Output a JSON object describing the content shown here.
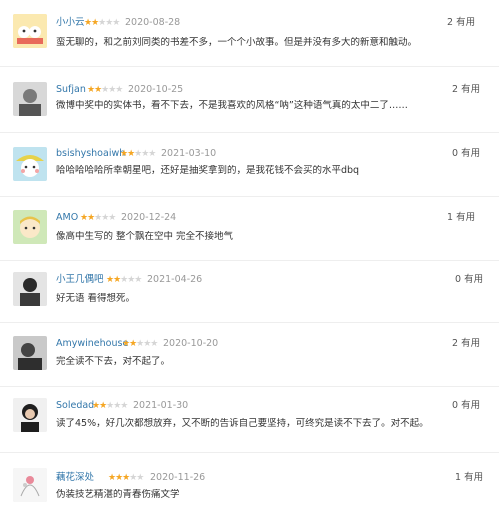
{
  "reviews": [
    {
      "user": "小小云",
      "rating": 2,
      "date": "2020-08-28",
      "text": "蛮无聊的，和之前刘同类的书差不多，一个个小故事。但是并没有多大的新意和触动。",
      "useful": "2 有用"
    },
    {
      "user": "Sufjan",
      "rating": 2,
      "date": "2020-10-25",
      "text": "微博中奖中的实体书，看不下去，不是我喜欢的风格“呐”这种语气真的太中二了……",
      "useful": "2 有用"
    },
    {
      "user": "bsishyshoaiwh",
      "rating": 2,
      "date": "2021-03-10",
      "text": "哈哈哈哈哈所幸朝星吧，还好是抽奖拿到的，是我花钱不会买的水平dbq",
      "useful": "0 有用"
    },
    {
      "user": "AMO",
      "rating": 2,
      "date": "2020-12-24",
      "text": "像高中生写的 整个飘在空中 完全不接地气",
      "useful": "1 有用"
    },
    {
      "user": "小王几偶吧",
      "rating": 2,
      "date": "2021-04-26",
      "text": "好无语 看得想死。",
      "useful": "0 有用"
    },
    {
      "user": "Amywinehouse",
      "rating": 2,
      "date": "2020-10-20",
      "text": "完全读不下去，对不起了。",
      "useful": "2 有用"
    },
    {
      "user": "Soledad",
      "rating": 2,
      "date": "2021-01-30",
      "text": "读了45%，好几次都想放弃，又不断的告诉自己要坚持，可终究是读不下去了。对不起。",
      "useful": "0 有用"
    },
    {
      "user": "藕花深处",
      "rating": 3,
      "date": "2020-11-26",
      "text": "伪装技艺精湛的青春伤痛文学",
      "useful": "1 有用"
    }
  ]
}
